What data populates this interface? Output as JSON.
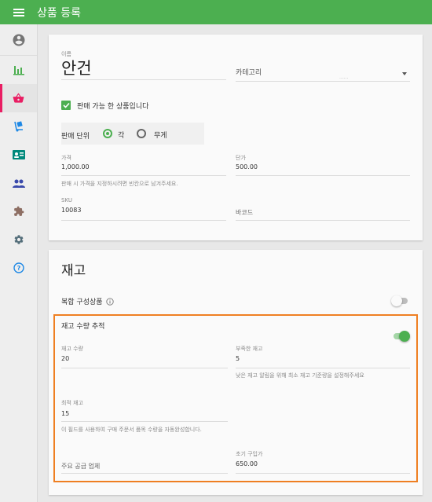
{
  "appbar": {
    "title": "상품 등록"
  },
  "sidebar": {
    "items": [
      {
        "icon": "account-circle-icon"
      },
      {
        "icon": "bar-chart-icon"
      },
      {
        "icon": "basket-icon",
        "active": true
      },
      {
        "icon": "dolly-icon"
      },
      {
        "icon": "contact-card-icon"
      },
      {
        "icon": "people-icon"
      },
      {
        "icon": "puzzle-icon"
      },
      {
        "icon": "gear-icon"
      },
      {
        "icon": "help-icon"
      }
    ],
    "accent": "#e91e63"
  },
  "product": {
    "name_label": "이름",
    "name_value": "안건",
    "category_placeholder": "카테고리",
    "category_dots": "......",
    "available_label": "판매 가능 한 상품입니다",
    "unit_label": "판매 단위",
    "unit_each": "각",
    "unit_weight": "무게",
    "price_label": "가격",
    "price_value": "1,000.00",
    "unit_price_label": "단가",
    "unit_price_value": "500.00",
    "price_hint": "판매 시 가격을 지정하시려면 빈칸으로 남겨주세요.",
    "sku_label": "SKU",
    "sku_value": "10083",
    "barcode_placeholder": "바코드"
  },
  "inventory": {
    "title": "재고",
    "composite_label": "복합 구성상품",
    "track_label": "재고 수량 추적",
    "qty_label": "재고 수량",
    "qty_value": "20",
    "low_label": "부족한 재고",
    "low_value": "5",
    "low_hint": "낮은 재고 알림을 위해 최소 재고 기준량을 설정해주세요",
    "optimal_label": "최적 재고",
    "optimal_value": "15",
    "optimal_hint": "이 필드를 사용하여 구매 주문서 품목 수량을 자동완성합니다.",
    "supplier_placeholder": "주요 공급 업체",
    "cost_label": "초기 구입가",
    "cost_value": "650.00"
  },
  "colors": {
    "appbar": "#4caf50",
    "highlight": "#ef7f22",
    "toggle_on": "#4caf50"
  }
}
